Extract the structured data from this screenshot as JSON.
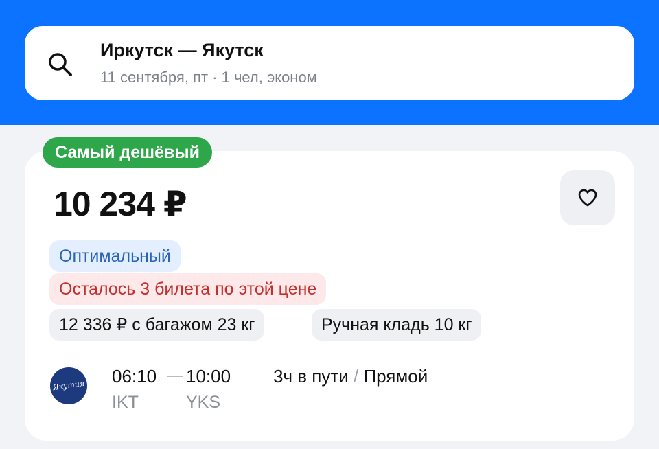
{
  "search": {
    "route": "Иркутск — Якутск",
    "details": "11 сентября, пт · 1 чел, эконом"
  },
  "offer": {
    "badge": "Самый дешёвый",
    "price": "10 234 ₽",
    "tags": {
      "optimal": "Оптимальный",
      "remaining": "Осталось 3 билета по этой цене",
      "baggage": "12 336 ₽ с багажом 23 кг",
      "hand_luggage": "Ручная кладь 10 кг"
    },
    "airline_logo_text": "Якутия",
    "flight": {
      "departure_time": "06:10",
      "arrival_time": "10:00",
      "departure_code": "IKT",
      "arrival_code": "YKS",
      "duration": "3ч в пути",
      "separator": " / ",
      "type": "Прямой"
    }
  },
  "colors": {
    "header_bg": "#0b73ff",
    "badge_green": "#2ea64a",
    "optimal_blue": "#2a64b8",
    "remaining_red": "#c4302d"
  },
  "icons": {
    "search": "search-icon",
    "favorite": "heart-icon"
  }
}
